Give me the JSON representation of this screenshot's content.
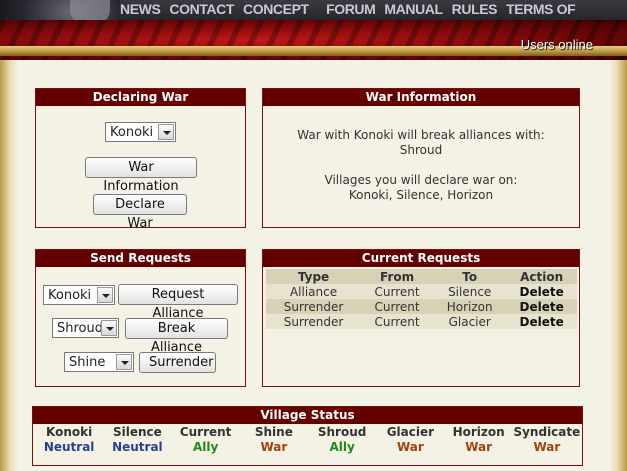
{
  "nav": {
    "items": [
      "NEWS",
      "CONTACT",
      "CONCEPT ART",
      "FORUM",
      "MANUAL",
      "RULES",
      "TERMS OF SERVICE"
    ]
  },
  "header": {
    "users_online": "Users online"
  },
  "declaring_war": {
    "title": "Declaring War",
    "village_select": "Konoki",
    "war_info_button": "War Information",
    "declare_war_button": "Declare War"
  },
  "war_information": {
    "title": "War Information",
    "line1": "War with Konoki will break alliances with:",
    "line2": "Shroud",
    "line3": "Villages you will declare war on:",
    "line4": "Konoki, Silence, Horizon"
  },
  "send_requests": {
    "title": "Send Requests",
    "rows": [
      {
        "select": "Konoki",
        "button": "Request Alliance"
      },
      {
        "select": "Shroud",
        "button": "Break Alliance"
      },
      {
        "select": "Shine",
        "button": "Surrender"
      }
    ]
  },
  "current_requests": {
    "title": "Current Requests",
    "columns": [
      "Type",
      "From",
      "To",
      "Action"
    ],
    "rows": [
      {
        "type": "Alliance",
        "from": "Current",
        "to": "Silence",
        "action": "Delete"
      },
      {
        "type": "Surrender",
        "from": "Current",
        "to": "Horizon",
        "action": "Delete"
      },
      {
        "type": "Surrender",
        "from": "Current",
        "to": "Glacier",
        "action": "Delete"
      }
    ]
  },
  "village_status": {
    "title": "Village Status",
    "villages": [
      {
        "name": "Konoki",
        "status": "Neutral"
      },
      {
        "name": "Silence",
        "status": "Neutral"
      },
      {
        "name": "Current",
        "status": "Ally"
      },
      {
        "name": "Shine",
        "status": "War"
      },
      {
        "name": "Shroud",
        "status": "Ally"
      },
      {
        "name": "Glacier",
        "status": "War"
      },
      {
        "name": "Horizon",
        "status": "War"
      },
      {
        "name": "Syndicate",
        "status": "War"
      }
    ]
  },
  "colors": {
    "panel_header": "#650000",
    "neutral": "#2a3f9a",
    "ally": "#1f8a1f",
    "war": "#a3410f"
  }
}
